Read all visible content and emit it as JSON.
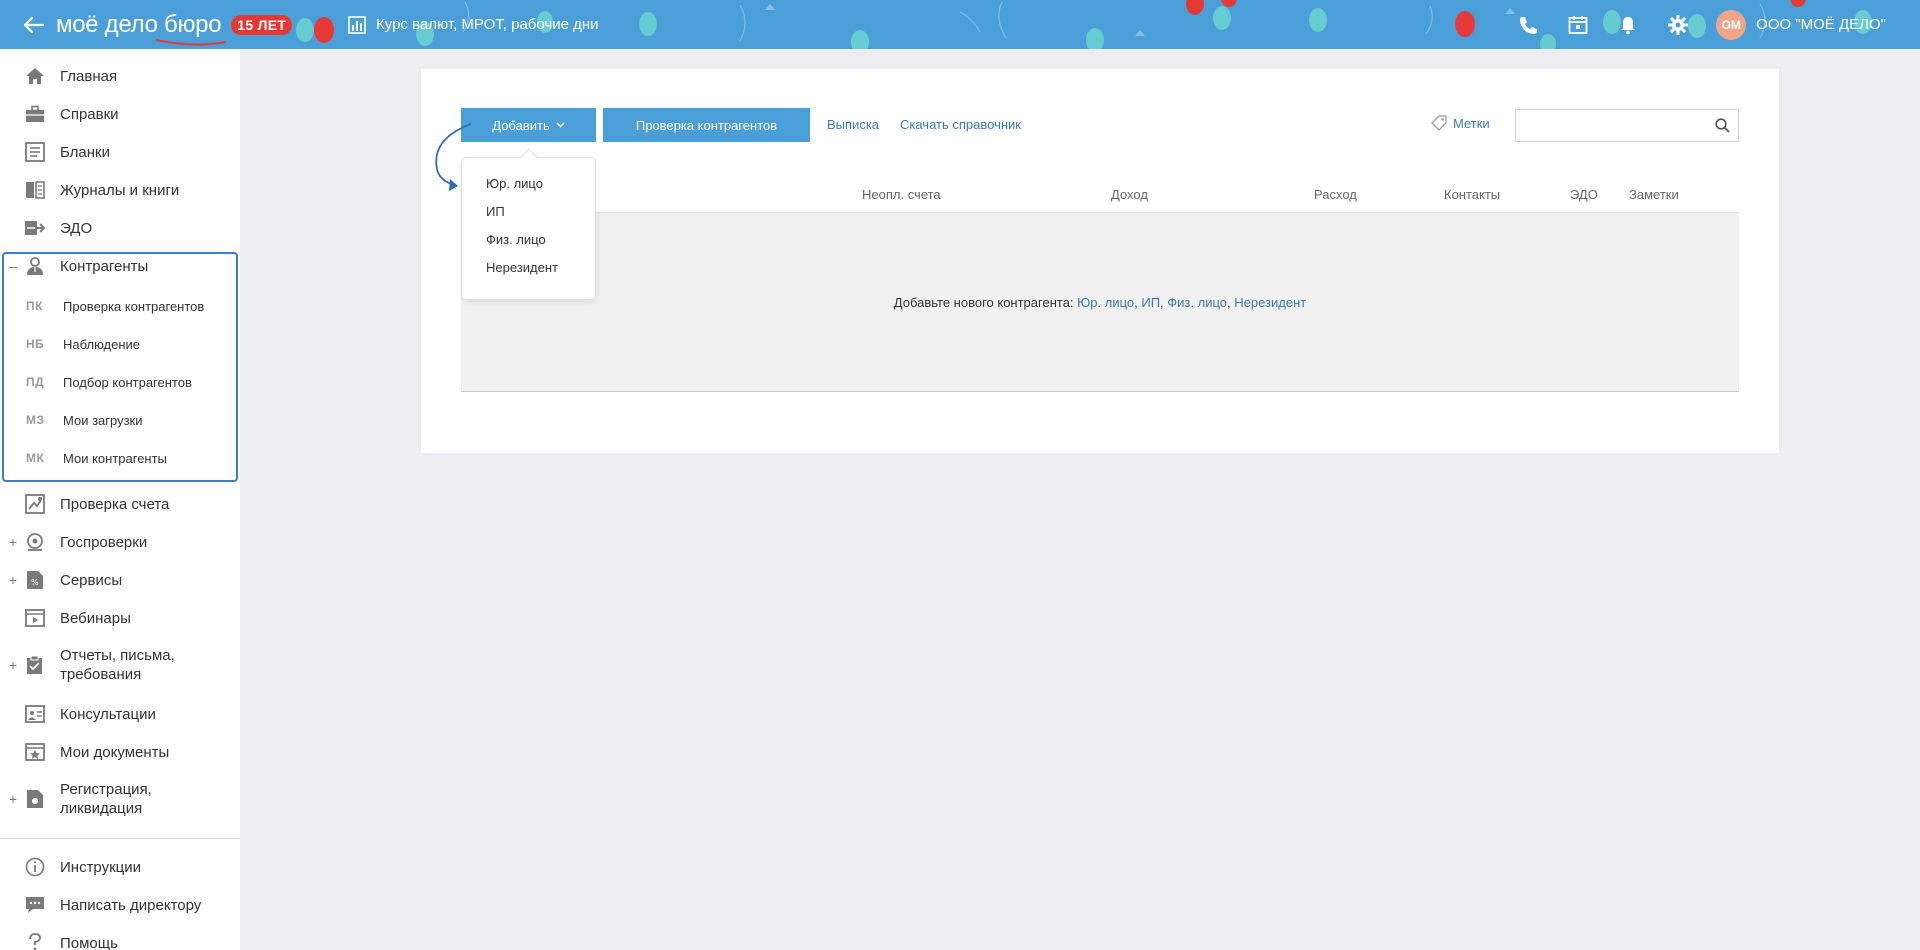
{
  "header": {
    "logo": "моё дело бюро",
    "badge": "15 ЛЕТ",
    "rates_link": "Курс валют, МРОТ, рабочие дни",
    "avatar_initials": "ОМ",
    "company": "ООО \"МОЁ ДЕЛО\"",
    "colors": {
      "bar": "#4a9fd8",
      "badge": "#e53935",
      "avatar": "#f0a589"
    },
    "icons": [
      "back-arrow-icon",
      "chart-icon",
      "phone-icon",
      "calendar-icon",
      "bell-icon",
      "gear-icon"
    ]
  },
  "sidebar": {
    "items": [
      {
        "label": "Главная",
        "icon": "home-icon",
        "expandable": false
      },
      {
        "label": "Справки",
        "icon": "briefcase-icon",
        "expandable": false
      },
      {
        "label": "Бланки",
        "icon": "forms-icon",
        "expandable": false
      },
      {
        "label": "Журналы и книги",
        "icon": "journal-icon",
        "expandable": false
      },
      {
        "label": "ЭДО",
        "icon": "edo-icon",
        "expandable": false
      },
      {
        "label": "Контрагенты",
        "icon": "contractor-icon",
        "expandable": true,
        "expanded": true,
        "toggle": "–"
      },
      {
        "label": "Проверка счета",
        "icon": "account-check-icon",
        "expandable": false
      },
      {
        "label": "Госпроверки",
        "icon": "inspection-icon",
        "expandable": true,
        "toggle": "+"
      },
      {
        "label": "Сервисы",
        "icon": "services-icon",
        "expandable": true,
        "toggle": "+"
      },
      {
        "label": "Вебинары",
        "icon": "webinar-icon",
        "expandable": false
      },
      {
        "label": "Отчеты, письма,\nтребования",
        "icon": "reports-icon",
        "expandable": true,
        "toggle": "+"
      },
      {
        "label": "Консультации",
        "icon": "consult-icon",
        "expandable": false
      },
      {
        "label": "Мои документы",
        "icon": "my-docs-icon",
        "expandable": false
      },
      {
        "label": "Регистрация,\nликвидация",
        "icon": "registration-icon",
        "expandable": true,
        "toggle": "+"
      }
    ],
    "subitems": [
      {
        "abbr": "ПК",
        "label": "Проверка контрагентов"
      },
      {
        "abbr": "НБ",
        "label": "Наблюдение"
      },
      {
        "abbr": "ПД",
        "label": "Подбор контрагентов"
      },
      {
        "abbr": "МЗ",
        "label": "Мои загрузки"
      },
      {
        "abbr": "МК",
        "label": "Мои контрагенты"
      }
    ],
    "bottom": [
      {
        "label": "Инструкции",
        "icon": "info-icon"
      },
      {
        "label": "Написать директору",
        "icon": "message-icon"
      },
      {
        "label": "Помощь",
        "icon": "help-icon"
      }
    ]
  },
  "toolbar": {
    "add_label": "Добавить",
    "check_label": "Проверка контрагентов",
    "statement_link": "Выписка",
    "download_link": "Скачать справочник",
    "tags_label": "Метки",
    "search_placeholder": ""
  },
  "dropdown": {
    "items": [
      "Юр. лицо",
      "ИП",
      "Физ. лицо",
      "Нерезидент"
    ]
  },
  "table": {
    "columns": [
      "Неопл. счета",
      "Доход",
      "Расход",
      "Контакты",
      "ЭДО",
      "Заметки"
    ],
    "empty_text": "Добавьте нового контрагента: ",
    "empty_links": [
      "Юр. лицо",
      "ИП",
      "Физ. лицо",
      "Нерезидент"
    ]
  }
}
